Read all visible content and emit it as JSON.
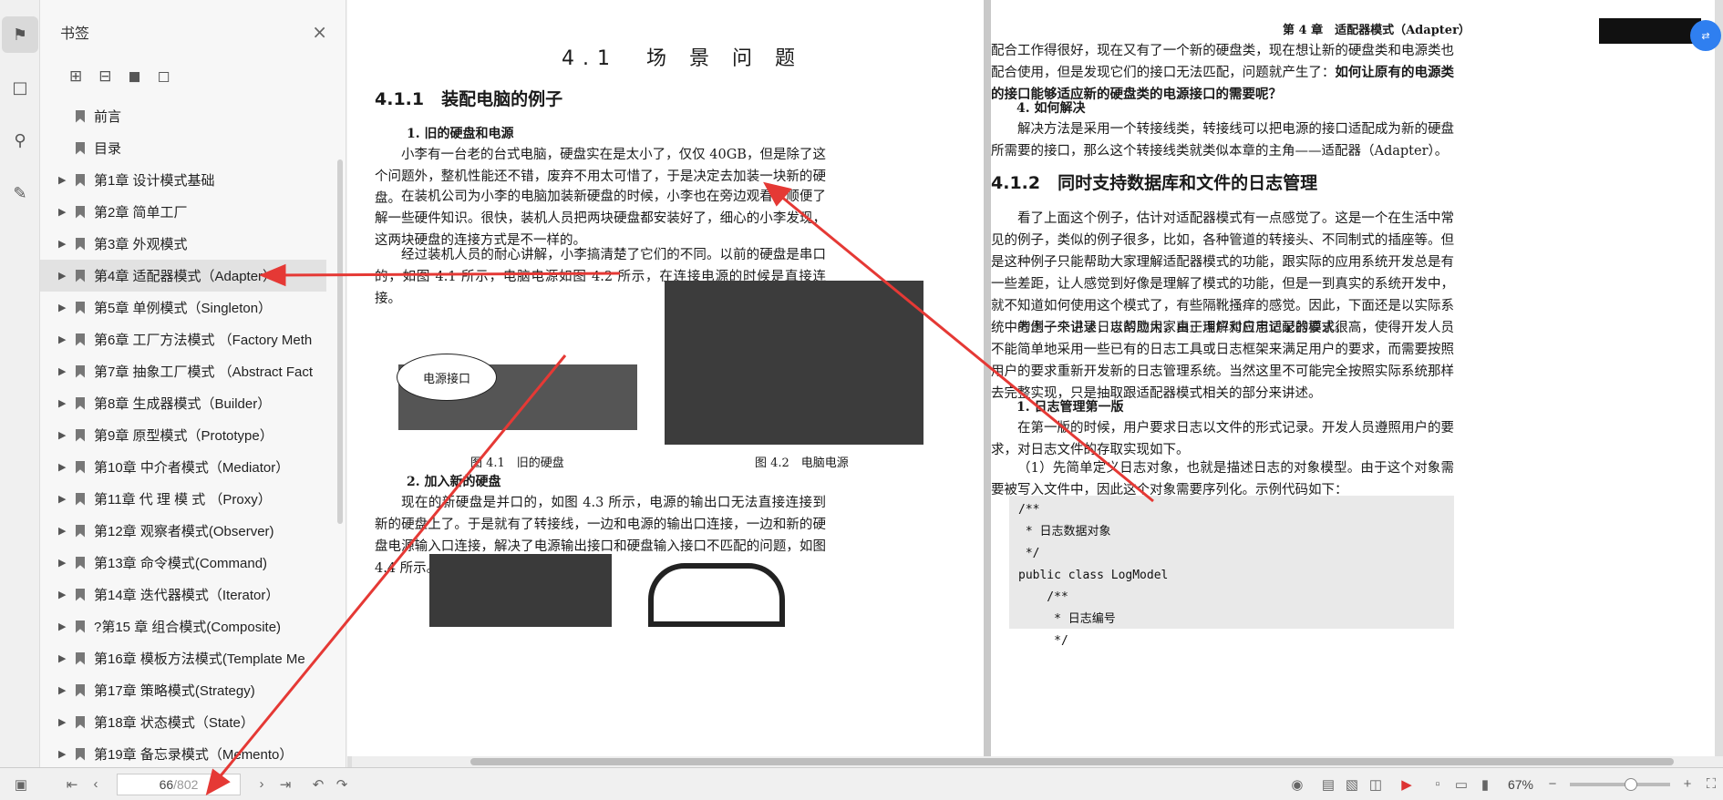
{
  "sidebar": {
    "title": "书签",
    "close_icon": "×",
    "items": [
      {
        "label": "前言",
        "expandable": false
      },
      {
        "label": "目录",
        "expandable": false
      },
      {
        "label": "第1章 设计模式基础",
        "expandable": true
      },
      {
        "label": "第2章 简单工厂",
        "expandable": true
      },
      {
        "label": "第3章 外观模式",
        "expandable": true
      },
      {
        "label": "第4章 适配器模式（Adapter）",
        "expandable": true,
        "selected": true
      },
      {
        "label": "第5章 单例模式（Singleton）",
        "expandable": true
      },
      {
        "label": "第6章 工厂方法模式 （Factory Meth",
        "expandable": true
      },
      {
        "label": "第7章 抽象工厂模式 （Abstract Fact",
        "expandable": true
      },
      {
        "label": "第8章 生成器模式（Builder）",
        "expandable": true
      },
      {
        "label": "第9章 原型模式（Prototype）",
        "expandable": true
      },
      {
        "label": "第10章 中介者模式（Mediator）",
        "expandable": true
      },
      {
        "label": "第11章 代 理 模 式 （Proxy）",
        "expandable": true
      },
      {
        "label": "第12章 观察者模式(Observer)",
        "expandable": true
      },
      {
        "label": "第13章 命令模式(Command)",
        "expandable": true
      },
      {
        "label": "第14章 迭代器模式（Iterator）",
        "expandable": true
      },
      {
        "label": "?第15 章 组合模式(Composite)",
        "expandable": true
      },
      {
        "label": "第16章 模板方法模式(Template Me",
        "expandable": true
      },
      {
        "label": "第17章 策略模式(Strategy)",
        "expandable": true
      },
      {
        "label": "第18章 状态模式（State）",
        "expandable": true
      },
      {
        "label": "第19章 备忘录模式（Memento）",
        "expandable": true
      }
    ]
  },
  "left_page": {
    "title": "4.1　场 景 问 题",
    "section": "4.1.1　装配电脑的例子",
    "sub1": "1. 旧的硬盘和电源",
    "p1": "小李有一台老的台式电脑，硬盘实在是太小了，仅仅 40GB，但是除了这个问题外，整机性能还不错，废弃不用太可惜了，于是决定去加装一块新的硬盘。",
    "p2": "在装机公司为小李的电脑加装新硬盘的时候，小李也在旁边观看，顺便了解一些硬件知识。很快，装机人员把两块硬盘都安装好了，细心的小李发现，这两块硬盘的连接方式是不一样的。",
    "p3": "经过装机人员的耐心讲解，小李搞清楚了它们的不同。以前的硬盘是串口的，如图 4.1 所示，电脑电源如图 4.2 所示，在连接电源的时候是直接连接。",
    "fig_label": "电源接口",
    "cap1": "图 4.1　旧的硬盘",
    "cap2": "图 4.2　电脑电源",
    "sub2": "2. 加入新的硬盘",
    "p4": "现在的新硬盘是并口的，如图 4.3 所示，电源的输出口无法直接连接到新的硬盘上了。于是就有了转接线，一边和电源的输出口连接，一边和新的硬盘电源输入口连接，解决了电源输出接口和硬盘输入接口不匹配的问题，如图 4.4 所示。"
  },
  "right_page": {
    "header": "第 4 章　适配器模式（Adapter）",
    "p1": "配合工作得很好，现在又有了一个新的硬盘类，现在想让新的硬盘类和电源类也配合使用，但是发现它们的接口无法匹配，问题就产生了：",
    "p1_bold": "如何让原有的电源类的接口能够适应新的硬盘类的电源接口的需要呢？",
    "sub4": "4. 如何解决",
    "p2": "解决方法是采用一个转接线类，转接线可以把电源的接口适配成为新的硬盘所需要的接口，那么这个转接线类就类似本章的主角——适配器（Adapter）。",
    "section": "4.1.2　同时支持数据库和文件的日志管理",
    "p3": "看了上面这个例子，估计对适配器模式有一点感觉了。这是一个在生活中常见的例子，类似的例子很多，比如，各种管道的转接头、不同制式的插座等。但是这种例子只能帮助大家理解适配器模式的功能，跟实际的应用系统开发总是有一些差距，让人感觉到好像是理解了模式的功能，但是一到真实的系统开发中，就不知道如何使用这个模式了，有些隔靴搔痒的感觉。因此，下面还是以实际系统中的例子来讲述，以帮助大家真正理解和应用适配器模式。",
    "p4": "考虑一个记录日志的应用，由于用户对日志记录的要求很高，使得开发人员不能简单地采用一些已有的日志工具或日志框架来满足用户的要求，而需要按照用户的要求重新开发新的日志管理系统。当然这里不可能完全按照实际系统那样去完整实现，只是抽取跟适配器模式相关的部分来讲述。",
    "sub1": "1. 日志管理第一版",
    "p5": "在第一版的时候，用户要求日志以文件的形式记录。开发人员遵照用户的要求，对日志文件的存取实现如下。",
    "p6": "（1）先简单定义日志对象，也就是描述日志的对象模型。由于这个对象需要被写入文件中，因此这个对象需要序列化。示例代码如下：",
    "code": "/**\n * 日志数据对象\n */\npublic class LogModel\n    /**\n     * 日志编号\n     */"
  },
  "status": {
    "current_page": "66",
    "total_pages": "/802",
    "zoom": "67%"
  }
}
